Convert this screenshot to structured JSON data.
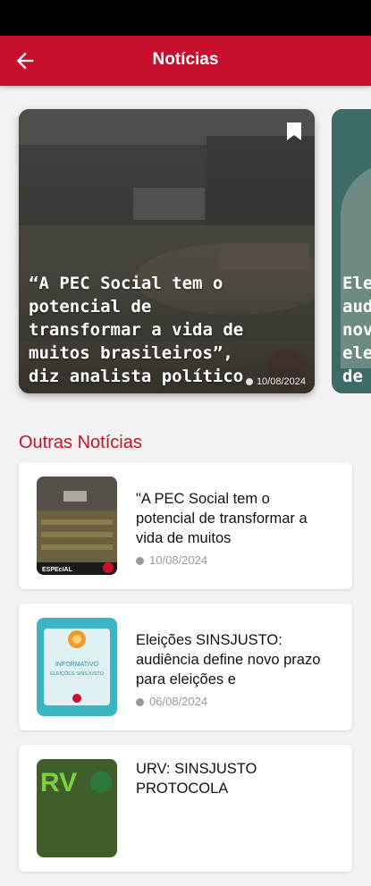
{
  "header": {
    "title": "Notícias"
  },
  "carousel": {
    "cards": [
      {
        "headline": "“A PEC Social tem o potencial de transformar a vida de muitos brasileiros”, diz analista político",
        "date": "10/08/2024"
      },
      {
        "headline": "Ele\naud\nnov\nele\nde"
      }
    ]
  },
  "section": {
    "title": "Outras Notícias"
  },
  "news": [
    {
      "title": "\"A PEC Social tem o potencial de transformar a vida de muitos",
      "date": "10/08/2024",
      "thumb_label": "ESPEcIAL"
    },
    {
      "title": "Eleições SINSJUSTO: audiência define novo prazo para eleições e",
      "date": "06/08/2024",
      "thumb_label_1": "INFORMATIVO",
      "thumb_label_2": "ELEIÇÕES SINSJUSTO"
    },
    {
      "title": "URV: SINSJUSTO PROTOCOLA",
      "thumb_label": "RV"
    }
  ],
  "colors": {
    "primary": "#c8102e",
    "background": "#f2f2f2"
  },
  "icons": {
    "back": "arrow-left-icon",
    "bookmark": "bookmark-icon",
    "date": "clock-icon"
  }
}
